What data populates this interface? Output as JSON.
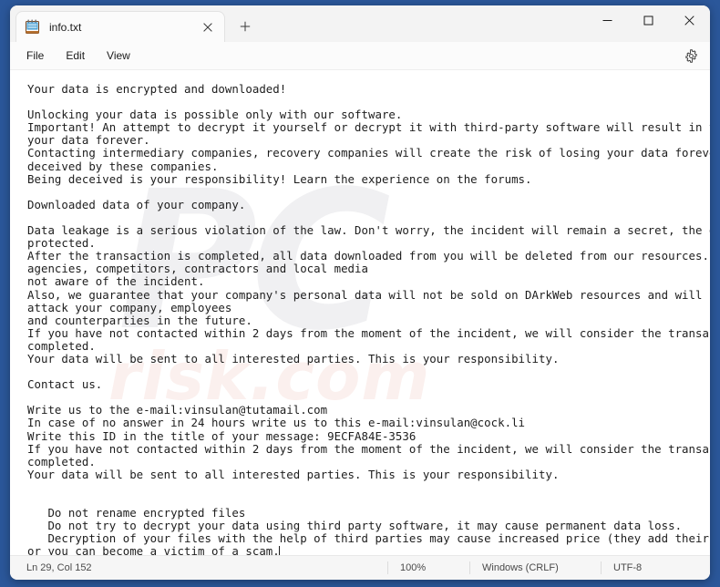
{
  "window": {
    "tab": {
      "title": "info.txt",
      "icon": "notepad-icon",
      "close_icon": "close-icon"
    },
    "new_tab_icon": "plus-icon",
    "controls": {
      "minimize": "minimize-icon",
      "maximize": "maximize-icon",
      "close": "close-icon"
    }
  },
  "menubar": {
    "items": [
      {
        "label": "File"
      },
      {
        "label": "Edit"
      },
      {
        "label": "View"
      }
    ],
    "settings_icon": "gear-icon"
  },
  "watermark": {
    "mark_top": "PC",
    "mark_bottom": "risk.com"
  },
  "editor": {
    "content": "Your data is encrypted and downloaded!\n\nUnlocking your data is possible only with our software.\nImportant! An attempt to decrypt it yourself or decrypt it with third-party software will result in the loss of\nyour data forever.\nContacting intermediary companies, recovery companies will create the risk of losing your data forever or being\ndeceived by these companies.\nBeing deceived is your responsibility! Learn the experience on the forums.\n\nDownloaded data of your company.\n\nData leakage is a serious violation of the law. Don't worry, the incident will remain a secret, the data is\nprotected.\nAfter the transaction is completed, all data downloaded from you will be deleted from our resources. Government\nagencies, competitors, contractors and local media\nnot aware of the incident.\nAlso, we guarantee that your company's personal data will not be sold on DArkWeb resources and will not be used to\nattack your company, employees\nand counterparties in the future.\nIf you have not contacted within 2 days from the moment of the incident, we will consider the transaction not\ncompleted.\nYour data will be sent to all interested parties. This is your responsibility.\n\nContact us.\n\nWrite us to the e-mail:vinsulan@tutamail.com\nIn case of no answer in 24 hours write us to this e-mail:vinsulan@cock.li\nWrite this ID in the title of your message: 9ECFA84E-3536\nIf you have not contacted within 2 days from the moment of the incident, we will consider the transaction not\ncompleted.\nYour data will be sent to all interested parties. This is your responsibility.\n\n\n   Do not rename encrypted files\n   Do not try to decrypt your data using third party software, it may cause permanent data loss.\n   Decryption of your files with the help of third parties may cause increased price (they add their fee to our)\nor you can become a victim of a scam."
  },
  "statusbar": {
    "position": "Ln 29, Col 152",
    "zoom": "100%",
    "line_ending": "Windows (CRLF)",
    "encoding": "UTF-8"
  },
  "colors": {
    "desktop": "#2b579a",
    "window_bg": "#f3f3f3",
    "editor_bg": "#ffffff",
    "text": "#1d1d1d",
    "accent_close_hover": "#c42b1c"
  }
}
